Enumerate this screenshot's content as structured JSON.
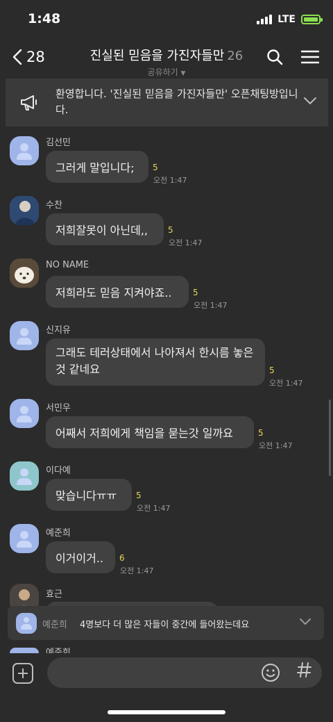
{
  "status": {
    "time": "1:48",
    "network": "LTE"
  },
  "header": {
    "back_count": "28",
    "title": "진실된 믿음을 가진자들만",
    "member_count": "26",
    "share_label": "공유하기"
  },
  "notice": {
    "text": "환영합니다. '진실된 믿음을 가진자들만' 오픈채팅방입니다."
  },
  "messages": [
    {
      "name": "김선민",
      "text": "그러게 말입니다;",
      "unread": "5",
      "time": "오전 1:47"
    },
    {
      "name": "수찬",
      "text": "저희잘못이 아닌데,,",
      "unread": "5",
      "time": "오전 1:47"
    },
    {
      "name": "NO NAME",
      "text": "저희라도 믿음 지켜야죠..",
      "unread": "5",
      "time": "오전 1:47"
    },
    {
      "name": "신지유",
      "text": "그래도 테러상태에서 나아져서 한시름 놓은 것 같네요",
      "unread": "5",
      "time": "오전 1:47"
    },
    {
      "name": "서민우",
      "text": "어째서 저희에게 책임을 묻는갓 일까요",
      "unread": "5",
      "time": "오전 1:47"
    },
    {
      "name": "이다예",
      "text": "맞습니다ㅠㅠ",
      "unread": "5",
      "time": "오전 1:47"
    },
    {
      "name": "예준희",
      "text": "이거이거..",
      "unread": "6",
      "time": "오전 1:47"
    },
    {
      "name": "효근"
    }
  ],
  "floating_preview": {
    "name": "예준희",
    "text": "4명보다 더 많은 자들이 중간에 들어왔는데요"
  },
  "peek_name": "예준희",
  "input": {
    "placeholder": ""
  },
  "colors": {
    "background": "#2b2b2b",
    "bubble": "#414141",
    "unread": "#e7d65b",
    "avatar_default": "#9fb4e8"
  }
}
